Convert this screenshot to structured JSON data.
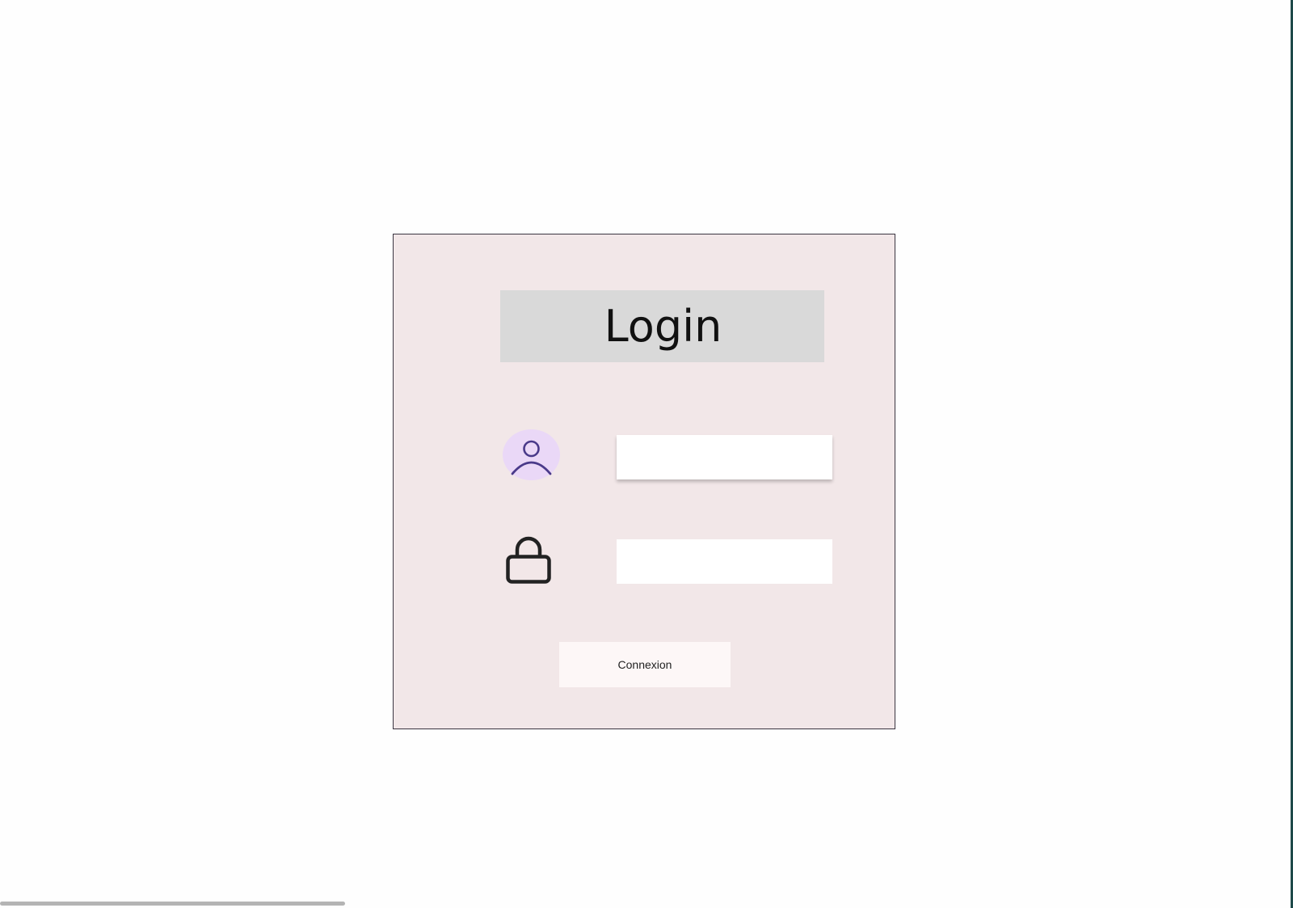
{
  "login_card": {
    "title": "Login",
    "username_field": {
      "value": "",
      "placeholder": ""
    },
    "password_field": {
      "value": "",
      "placeholder": ""
    },
    "submit_label": "Connexion"
  },
  "icons": {
    "user": "user-icon",
    "lock": "lock-icon"
  },
  "colors": {
    "card_background": "#f2e7e8",
    "title_background": "#d9d9d9",
    "user_icon_background": "#ead8f7",
    "user_icon_stroke": "#4a3a8a",
    "button_background": "#fdf7f7"
  }
}
